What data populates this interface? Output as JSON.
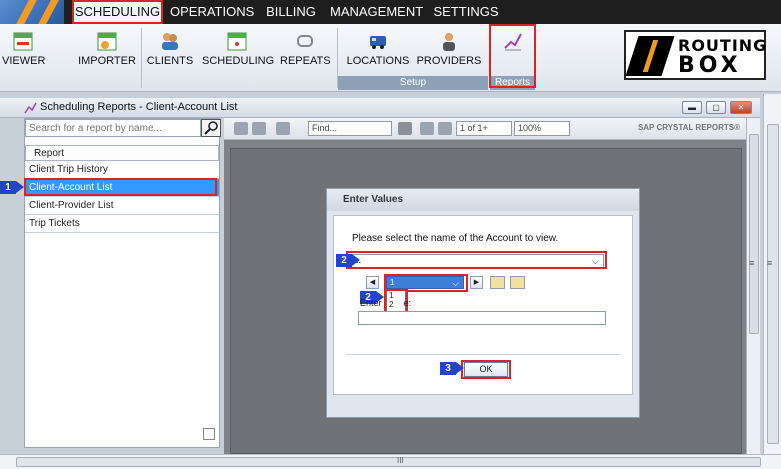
{
  "menubar": {
    "items": [
      "SCHEDULING",
      "OPERATIONS",
      "BILLING",
      "MANAGEMENT",
      "SETTINGS"
    ]
  },
  "ribbon": {
    "buttons": [
      "VIEWER",
      "IMPORTER",
      "CLIENTS",
      "SCHEDULING",
      "REPEATS",
      "LOCATIONS",
      "PROVIDERS"
    ],
    "groups": {
      "setup": "Setup",
      "reports": "Reports"
    }
  },
  "brand": {
    "line1": "ROUTING",
    "line2": "BOX"
  },
  "window": {
    "title": "Scheduling Reports - Client-Account List"
  },
  "left": {
    "search_placeholder": "Search for a report by name...",
    "list_header": "Report",
    "items": [
      "Client Trip History",
      "Client-Account List",
      "Client-Provider List",
      "Trip Tickets"
    ]
  },
  "viewer": {
    "find_placeholder": "Find...",
    "page": "1 of 1+",
    "zoom": "100%",
    "brand": "SAP CRYSTAL REPORTS®"
  },
  "dialog": {
    "title": "Enter Values",
    "prompt": "Please select the name of the Account to view.",
    "selected": "...",
    "inner_value": "1",
    "drop_items": [
      "1",
      "2"
    ],
    "enter_label_prefix": "Enter",
    "enter_label_suffix": "e:",
    "ok": "OK"
  },
  "steps": [
    "1",
    "2",
    "2",
    "3"
  ],
  "misc": {
    "scroll_mark": "III",
    "side_mark": "≡"
  }
}
